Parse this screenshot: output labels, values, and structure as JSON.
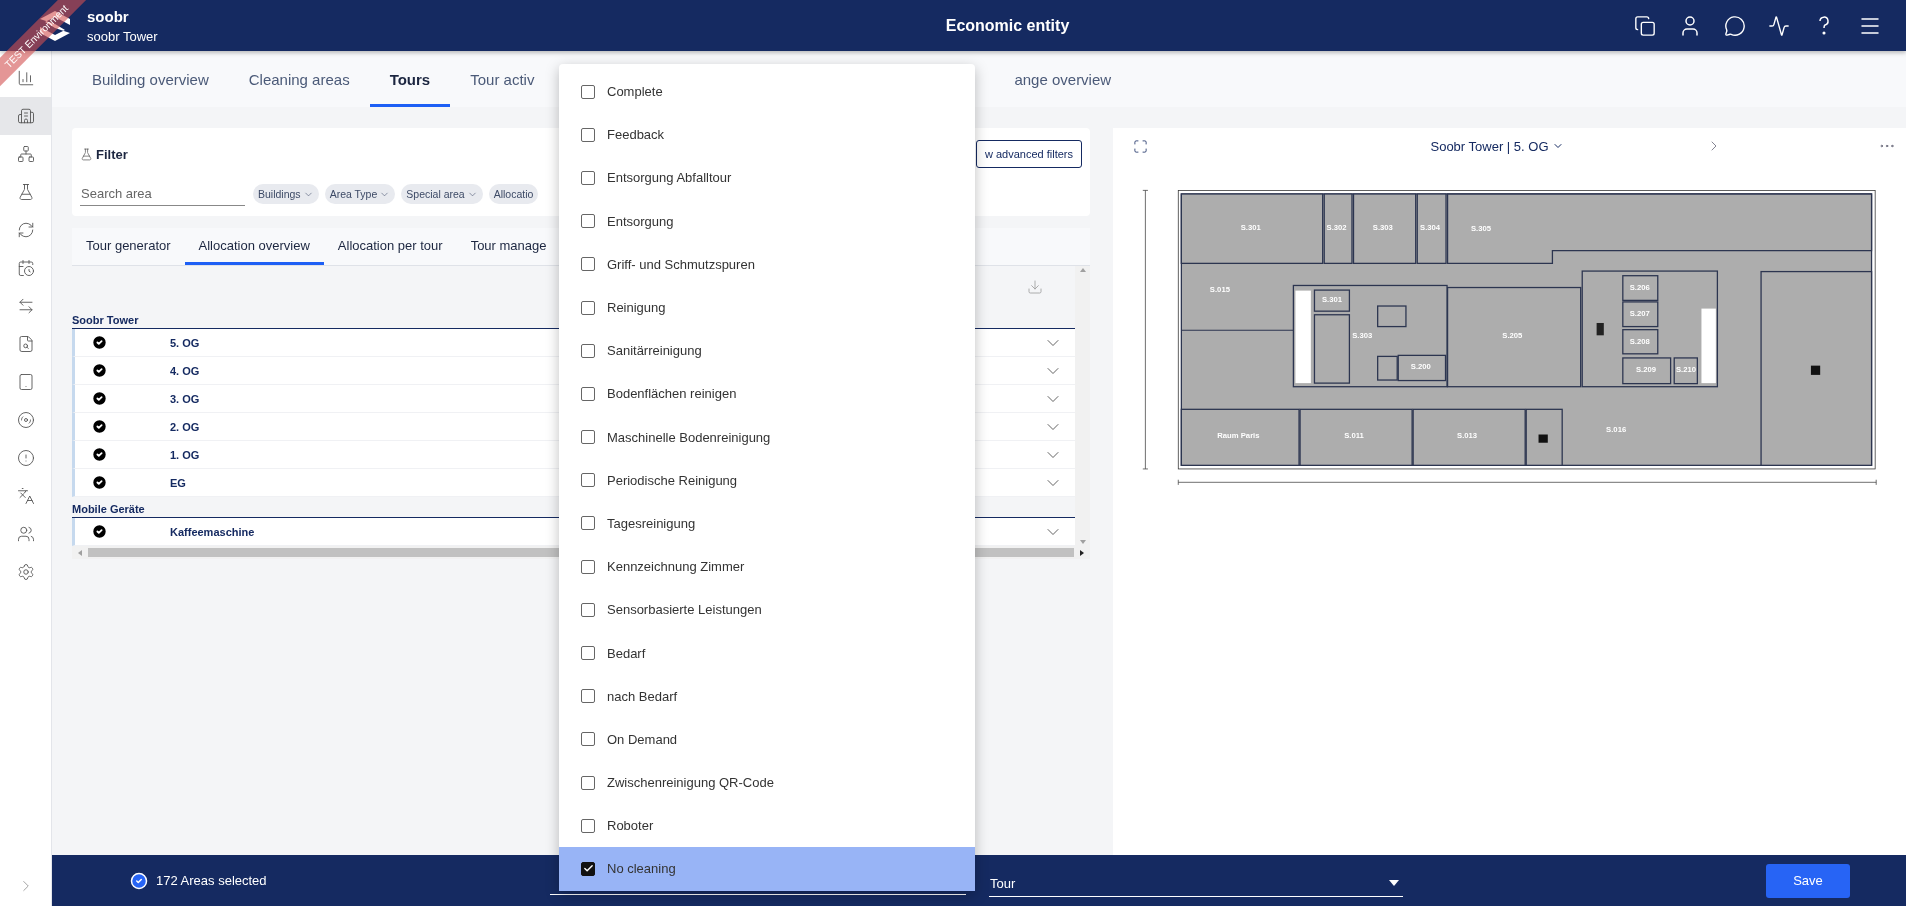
{
  "header": {
    "brand": "soobr",
    "building": "soobr Tower",
    "title": "Economic entity",
    "ribbon": "TEST Environment"
  },
  "sidebar": {
    "items": [
      {
        "selected": false
      },
      {
        "selected": true
      },
      {
        "selected": false
      },
      {
        "selected": false
      },
      {
        "selected": false
      },
      {
        "selected": false
      },
      {
        "selected": false
      },
      {
        "selected": false
      },
      {
        "selected": false
      },
      {
        "selected": false
      },
      {
        "selected": false
      },
      {
        "selected": false
      },
      {
        "selected": false
      },
      {
        "selected": false
      }
    ]
  },
  "tabs": [
    {
      "label": "Building overview",
      "selected": false
    },
    {
      "label": "Cleaning areas",
      "selected": false
    },
    {
      "label": "Tours",
      "selected": true
    },
    {
      "label": "Tour activ",
      "selected": false
    },
    {
      "label": "ange overview",
      "selected": false
    }
  ],
  "filter": {
    "title": "Filter",
    "search": {
      "placeholder": "Search area"
    },
    "chips": [
      "Buildings",
      "Area Type",
      "Special area",
      "Allocatio"
    ],
    "advanced_button": "w advanced filters"
  },
  "subtabs": [
    {
      "label": "Tour generator",
      "selected": false
    },
    {
      "label": "Allocation overview",
      "selected": true
    },
    {
      "label": "Allocation per tour",
      "selected": false
    },
    {
      "label": "Tour manage",
      "selected": false
    }
  ],
  "groups": [
    {
      "name": "Soobr Tower",
      "rows": [
        {
          "label": "5. OG",
          "checked": true
        },
        {
          "label": "4. OG",
          "checked": true
        },
        {
          "label": "3. OG",
          "checked": true
        },
        {
          "label": "2. OG",
          "checked": true
        },
        {
          "label": "1. OG",
          "checked": true
        },
        {
          "label": "EG",
          "checked": true
        }
      ]
    },
    {
      "name": "Mobile Geräte",
      "rows": [
        {
          "label": "Kaffeemaschine",
          "checked": true
        }
      ]
    }
  ],
  "map": {
    "title": "Soobr Tower | 5. OG",
    "rooms": [
      "S.301",
      "S.302",
      "S.303",
      "S.304",
      "S.305",
      "S.015",
      "S.301",
      "S.303",
      "S.205",
      "S.206",
      "S.207",
      "S.208",
      "S.200",
      "S.209",
      "S.210",
      "Raum Paris",
      "S.011",
      "S.013",
      "S.016"
    ]
  },
  "dropdown": {
    "options": [
      {
        "label": "Complete",
        "checked": false,
        "selected": false
      },
      {
        "label": "Feedback",
        "checked": false,
        "selected": false
      },
      {
        "label": "Entsorgung Abfalltour",
        "checked": false,
        "selected": false
      },
      {
        "label": "Entsorgung",
        "checked": false,
        "selected": false
      },
      {
        "label": "Griff- und Schmutzspuren",
        "checked": false,
        "selected": false
      },
      {
        "label": "Reinigung",
        "checked": false,
        "selected": false
      },
      {
        "label": "Sanitärreinigung",
        "checked": false,
        "selected": false
      },
      {
        "label": "Bodenflächen reinigen",
        "checked": false,
        "selected": false
      },
      {
        "label": "Maschinelle Bodenreinigung",
        "checked": false,
        "selected": false
      },
      {
        "label": "Periodische Reinigung",
        "checked": false,
        "selected": false
      },
      {
        "label": "Tagesreinigung",
        "checked": false,
        "selected": false
      },
      {
        "label": "Kennzeichnung Zimmer",
        "checked": false,
        "selected": false
      },
      {
        "label": "Sensorbasierte Leistungen",
        "checked": false,
        "selected": false
      },
      {
        "label": "Bedarf",
        "checked": false,
        "selected": false
      },
      {
        "label": "nach Bedarf",
        "checked": false,
        "selected": false
      },
      {
        "label": "On Demand",
        "checked": false,
        "selected": false
      },
      {
        "label": "Zwischenreinigung QR-Code",
        "checked": false,
        "selected": false
      },
      {
        "label": "Roboter",
        "checked": false,
        "selected": false
      },
      {
        "label": "No cleaning",
        "checked": true,
        "selected": true
      }
    ]
  },
  "bottom_bar": {
    "selection": "172 Areas selected",
    "tour_select": {
      "value": "Tour"
    },
    "save_button": "Save"
  }
}
